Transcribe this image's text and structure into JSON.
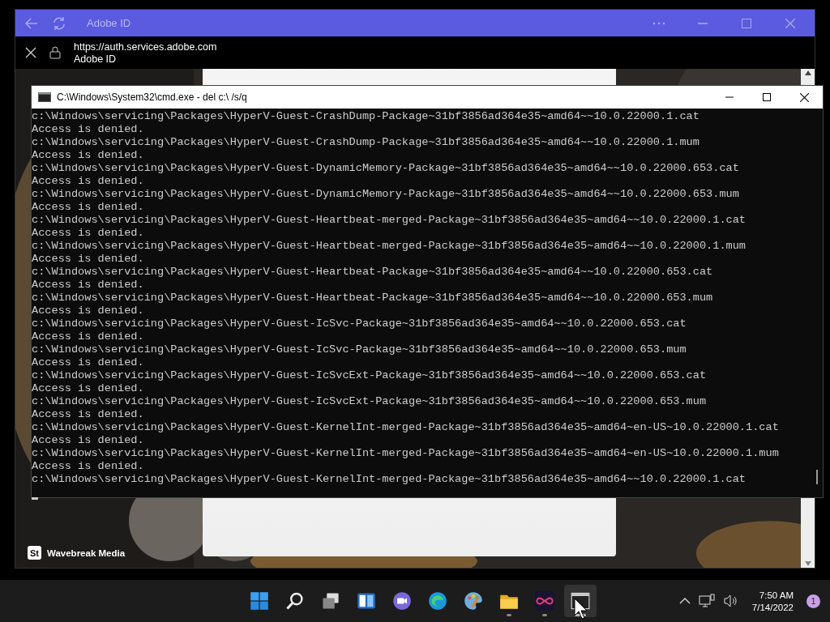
{
  "browser": {
    "title": "Adobe ID",
    "url": "https://auth.services.adobe.com",
    "page_title": "Adobe ID"
  },
  "photo_credit": {
    "badge": "St",
    "name": "Wavebreak Media"
  },
  "console": {
    "title": "C:\\Windows\\System32\\cmd.exe - del  c:\\ /s/q",
    "lines": [
      "c:\\Windows\\servicing\\Packages\\HyperV-Guest-CrashDump-Package~31bf3856ad364e35~amd64~~10.0.22000.1.cat",
      "Access is denied.",
      "c:\\Windows\\servicing\\Packages\\HyperV-Guest-CrashDump-Package~31bf3856ad364e35~amd64~~10.0.22000.1.mum",
      "Access is denied.",
      "c:\\Windows\\servicing\\Packages\\HyperV-Guest-DynamicMemory-Package~31bf3856ad364e35~amd64~~10.0.22000.653.cat",
      "Access is denied.",
      "c:\\Windows\\servicing\\Packages\\HyperV-Guest-DynamicMemory-Package~31bf3856ad364e35~amd64~~10.0.22000.653.mum",
      "Access is denied.",
      "c:\\Windows\\servicing\\Packages\\HyperV-Guest-Heartbeat-merged-Package~31bf3856ad364e35~amd64~~10.0.22000.1.cat",
      "Access is denied.",
      "c:\\Windows\\servicing\\Packages\\HyperV-Guest-Heartbeat-merged-Package~31bf3856ad364e35~amd64~~10.0.22000.1.mum",
      "Access is denied.",
      "c:\\Windows\\servicing\\Packages\\HyperV-Guest-Heartbeat-Package~31bf3856ad364e35~amd64~~10.0.22000.653.cat",
      "Access is denied.",
      "c:\\Windows\\servicing\\Packages\\HyperV-Guest-Heartbeat-Package~31bf3856ad364e35~amd64~~10.0.22000.653.mum",
      "Access is denied.",
      "c:\\Windows\\servicing\\Packages\\HyperV-Guest-IcSvc-Package~31bf3856ad364e35~amd64~~10.0.22000.653.cat",
      "Access is denied.",
      "c:\\Windows\\servicing\\Packages\\HyperV-Guest-IcSvc-Package~31bf3856ad364e35~amd64~~10.0.22000.653.mum",
      "Access is denied.",
      "c:\\Windows\\servicing\\Packages\\HyperV-Guest-IcSvcExt-Package~31bf3856ad364e35~amd64~~10.0.22000.653.cat",
      "Access is denied.",
      "c:\\Windows\\servicing\\Packages\\HyperV-Guest-IcSvcExt-Package~31bf3856ad364e35~amd64~~10.0.22000.653.mum",
      "Access is denied.",
      "c:\\Windows\\servicing\\Packages\\HyperV-Guest-KernelInt-merged-Package~31bf3856ad364e35~amd64~en-US~10.0.22000.1.cat",
      "Access is denied.",
      "c:\\Windows\\servicing\\Packages\\HyperV-Guest-KernelInt-merged-Package~31bf3856ad364e35~amd64~en-US~10.0.22000.1.mum",
      "Access is denied.",
      "c:\\Windows\\servicing\\Packages\\HyperV-Guest-KernelInt-merged-Package~31bf3856ad364e35~amd64~~10.0.22000.1.cat"
    ]
  },
  "taskbar": {
    "apps": [
      {
        "kind": "start",
        "running": false,
        "selected": false
      },
      {
        "kind": "search",
        "running": false,
        "selected": false
      },
      {
        "kind": "taskview",
        "running": false,
        "selected": false
      },
      {
        "kind": "widgets",
        "running": false,
        "selected": false
      },
      {
        "kind": "chat",
        "running": false,
        "selected": false
      },
      {
        "kind": "edge",
        "running": false,
        "selected": false
      },
      {
        "kind": "paint",
        "running": false,
        "selected": false
      },
      {
        "kind": "explorer",
        "running": true,
        "selected": false
      },
      {
        "kind": "cloud",
        "running": true,
        "selected": false
      },
      {
        "kind": "terminal",
        "running": true,
        "selected": true
      }
    ],
    "time": "7:50 AM",
    "date": "7/14/2022",
    "notifications": "1"
  }
}
